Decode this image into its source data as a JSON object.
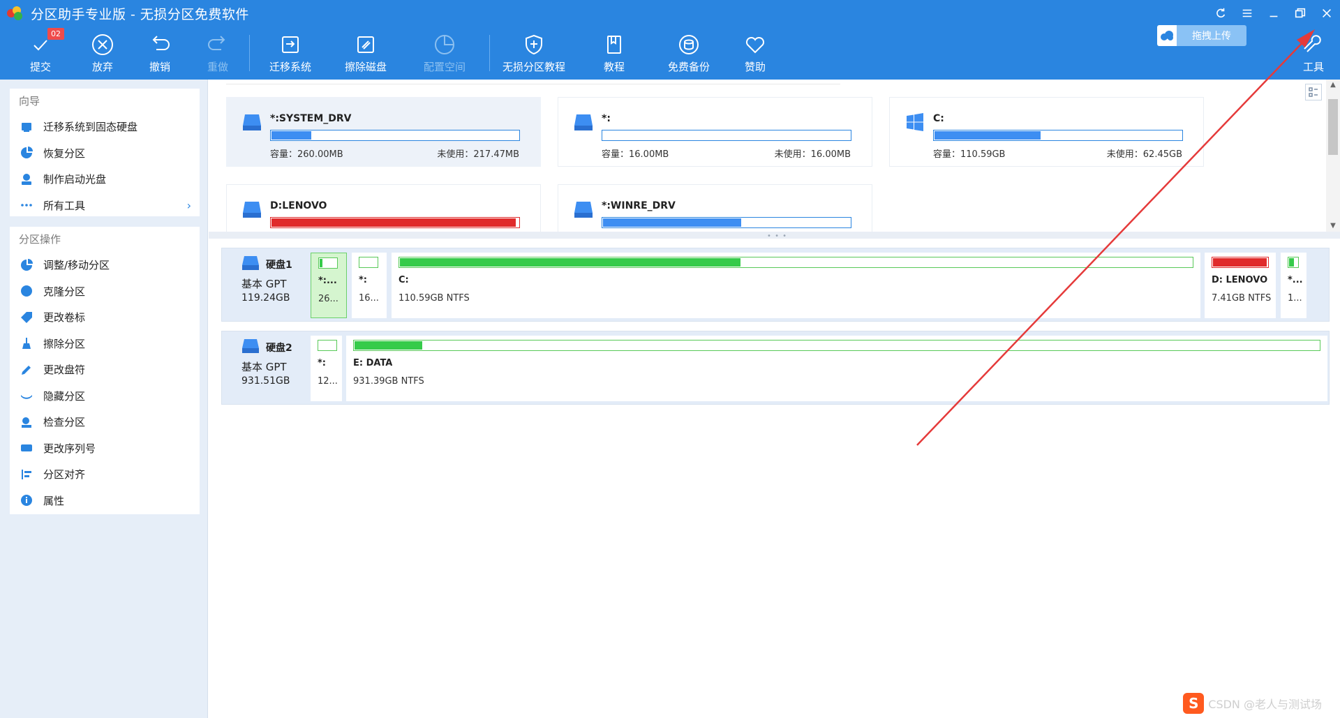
{
  "window": {
    "title": "分区助手专业版 - 无损分区免费软件"
  },
  "toolbar": {
    "commit": {
      "label": "提交",
      "badge": "02"
    },
    "discard": {
      "label": "放弃"
    },
    "undo": {
      "label": "撤销"
    },
    "redo": {
      "label": "重做"
    },
    "migrate": {
      "label": "迁移系统"
    },
    "wipe": {
      "label": "擦除磁盘"
    },
    "allocate": {
      "label": "配置空间"
    },
    "tutorial_lossless": {
      "label": "无损分区教程"
    },
    "tutorial": {
      "label": "教程"
    },
    "backup": {
      "label": "免费备份"
    },
    "donate": {
      "label": "赞助"
    },
    "tools": {
      "label": "工具"
    },
    "upload": {
      "label": "拖拽上传"
    }
  },
  "sidebar": {
    "wizard": {
      "title": "向导",
      "items": [
        {
          "label": "迁移系统到固态硬盘",
          "icon": "migrate-icon"
        },
        {
          "label": "恢复分区",
          "icon": "pie-icon"
        },
        {
          "label": "制作启动光盘",
          "icon": "boot-disk-icon"
        },
        {
          "label": "所有工具",
          "icon": "more-icon"
        }
      ]
    },
    "ops": {
      "title": "分区操作",
      "items": [
        {
          "label": "调整/移动分区"
        },
        {
          "label": "克隆分区"
        },
        {
          "label": "更改卷标"
        },
        {
          "label": "擦除分区"
        },
        {
          "label": "更改盘符"
        },
        {
          "label": "隐藏分区"
        },
        {
          "label": "检查分区"
        },
        {
          "label": "更改序列号"
        },
        {
          "label": "分区对齐"
        },
        {
          "label": "属性"
        }
      ]
    }
  },
  "cards": [
    {
      "name": "*:SYSTEM_DRV",
      "cap": "容量：260.00MB",
      "free": "未使用：217.47MB",
      "used_fraction": 0.16,
      "os": false,
      "color": "#3d8ef2"
    },
    {
      "name": "*:",
      "cap": "容量：16.00MB",
      "free": "未使用：16.00MB",
      "used_fraction": 0.0,
      "os": false,
      "color": "#3d8ef2"
    },
    {
      "name": "C:",
      "cap": "容量：110.59GB",
      "free": "未使用：62.45GB",
      "used_fraction": 0.43,
      "os": true,
      "color": "#3d8ef2"
    },
    {
      "name": "D:LENOVO",
      "cap": "",
      "free": "",
      "used_fraction": 0.99,
      "os": false,
      "color": "#e02b2b"
    },
    {
      "name": "*:WINRE_DRV",
      "cap": "",
      "free": "",
      "used_fraction": 0.56,
      "os": false,
      "color": "#3d8ef2"
    }
  ],
  "disks": [
    {
      "name": "硬盘1",
      "type": "基本 GPT",
      "size": "119.24GB",
      "partitions": [
        {
          "name": "*:...",
          "info": "26...",
          "used_fraction": 0.16
        },
        {
          "name": "*:",
          "info": "16...",
          "used_fraction": 0.0
        },
        {
          "name": "C:",
          "info": "110.59GB NTFS",
          "used_fraction": 0.43
        },
        {
          "name": "D: LENOVO",
          "info": "7.41GB NTFS",
          "used_fraction": 0.99
        },
        {
          "name": "*...",
          "info": "1...",
          "used_fraction": 0.56
        }
      ]
    },
    {
      "name": "硬盘2",
      "type": "基本 GPT",
      "size": "931.51GB",
      "partitions": [
        {
          "name": "*:",
          "info": "12...",
          "used_fraction": 0.0
        },
        {
          "name": "E: DATA",
          "info": "931.39GB NTFS",
          "used_fraction": 0.07
        }
      ]
    }
  ],
  "watermark": "CSDN @老人与测试场",
  "colors": {
    "accent": "#2a85e0",
    "used_green": "#36cb4a",
    "used_red": "#e02b2b",
    "used_blue": "#3d8ef2"
  }
}
